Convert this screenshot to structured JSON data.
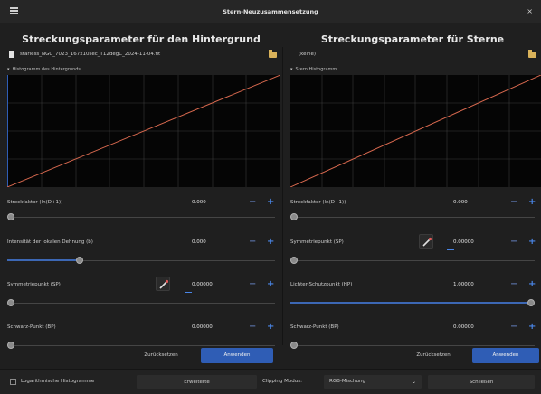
{
  "window": {
    "title": "Stern-Neuzusammensetzung",
    "close_glyph": "×"
  },
  "left": {
    "heading": "Streckungsparameter für den Hintergrund",
    "file_name": "starless_NGC_7023_167x10sec_T12degC_2024-11-04.fit",
    "histogram_label": "Histogramm des Hintergrunds",
    "params": [
      {
        "label": "Streckfaktor (ln(D+1))",
        "value": "0.000"
      },
      {
        "label": "Intensität der lokalen Dehnung (b)",
        "value": "0.000"
      },
      {
        "label": "Symmetriepunkt (SP)",
        "value": "0.00000"
      },
      {
        "label": "Schwarz-Punkt (BP)",
        "value": "0.00000"
      }
    ],
    "sliders": [
      0.0,
      0.26,
      0.0,
      0.0
    ],
    "reset_label": "Zurücksetzen",
    "apply_label": "Anwenden"
  },
  "right": {
    "heading": "Streckungsparameter für Sterne",
    "file_name": "(keine)",
    "histogram_label": "Stern Histogramm",
    "params": [
      {
        "label": "Streckfaktor (ln(D+1))",
        "value": "0.000"
      },
      {
        "label": "Symmetriepunkt (SP)",
        "value": "0.00000"
      },
      {
        "label": "Lichter-Schutzpunkt (HP)",
        "value": "1.00000"
      },
      {
        "label": "Schwarz-Punkt (BP)",
        "value": "0.00000"
      }
    ],
    "sliders": [
      0.0,
      0.0,
      1.0,
      0.0
    ],
    "reset_label": "Zurücksetzen",
    "apply_label": "Anwenden"
  },
  "bottom": {
    "log_histogram_label": "Logarithmische Histogramme",
    "advanced_label": "Erweiterte",
    "clipping_label": "Clipping Modus:",
    "clipping_value": "RGB-Mischung",
    "close_label": "Schließen"
  },
  "colors": {
    "accent": "#2f5db5",
    "curve": "#d9694f",
    "plus": "#4a86e8"
  }
}
